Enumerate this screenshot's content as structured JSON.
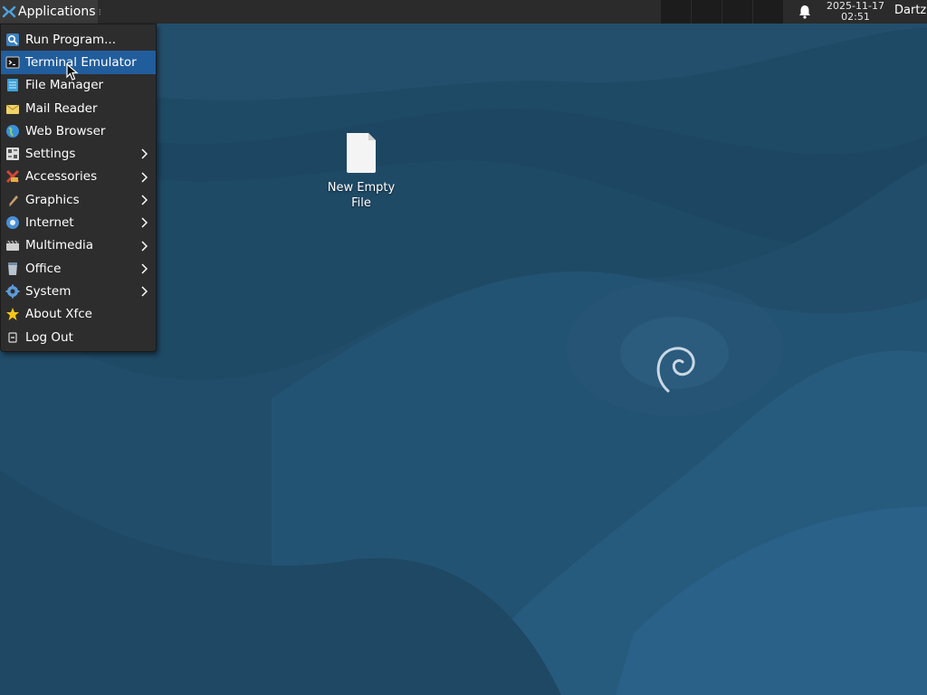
{
  "panel": {
    "applications_label": "Applications",
    "clock_date": "2025-11-17",
    "clock_time": "02:51",
    "user": "Dartz",
    "icons": [
      "xfce-logo-icon",
      "bell-icon"
    ]
  },
  "menu": {
    "items": [
      {
        "label": "Run Program...",
        "icon": "run-icon",
        "submenu": false
      },
      {
        "label": "Terminal Emulator",
        "icon": "terminal-icon",
        "submenu": false,
        "highlighted": true
      },
      {
        "label": "File Manager",
        "icon": "file-manager-icon",
        "submenu": false
      },
      {
        "label": "Mail Reader",
        "icon": "mail-icon",
        "submenu": false
      },
      {
        "label": "Web Browser",
        "icon": "globe-icon",
        "submenu": false
      },
      {
        "label": "Settings",
        "icon": "settings-icon",
        "submenu": true
      },
      {
        "label": "Accessories",
        "icon": "accessories-icon",
        "submenu": true
      },
      {
        "label": "Graphics",
        "icon": "graphics-icon",
        "submenu": true
      },
      {
        "label": "Internet",
        "icon": "internet-icon",
        "submenu": true
      },
      {
        "label": "Multimedia",
        "icon": "multimedia-icon",
        "submenu": true
      },
      {
        "label": "Office",
        "icon": "office-icon",
        "submenu": true
      },
      {
        "label": "System",
        "icon": "gear-icon",
        "submenu": true
      },
      {
        "label": "About Xfce",
        "icon": "star-icon",
        "submenu": false
      },
      {
        "label": "Log Out",
        "icon": "logout-icon",
        "submenu": false
      }
    ]
  },
  "desktop": {
    "file_label_line1": "New Empty",
    "file_label_line2": "File",
    "file_icon": "document-icon"
  },
  "colors": {
    "menu_bg": "#2d2d2d",
    "highlight": "#215d9c",
    "panel_bg": "#2b2b2b",
    "desktop_bg": "#1f4a66"
  }
}
